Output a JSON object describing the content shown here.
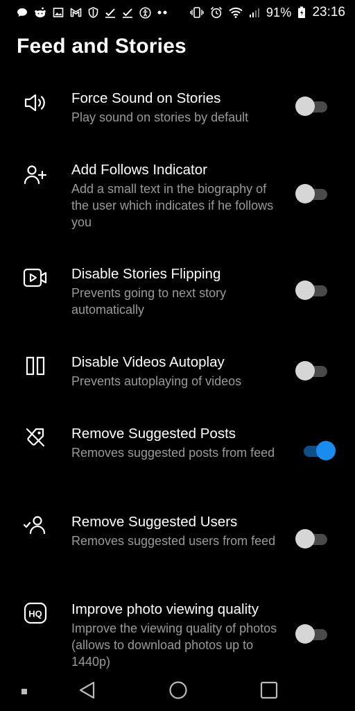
{
  "status_bar": {
    "left_icons": [
      "chat-bubble-icon",
      "reddit-icon",
      "image-icon",
      "gmail-icon",
      "shield-icon",
      "check-icon",
      "check-icon",
      "accessibility-icon",
      "more-dots-icon"
    ],
    "battery": "91%",
    "time": "23:16"
  },
  "page": {
    "title": "Feed and Stories"
  },
  "settings": [
    {
      "icon": "speaker-icon",
      "title": "Force Sound on Stories",
      "desc": "Play sound on stories by default",
      "enabled": false
    },
    {
      "icon": "add-user-icon",
      "title": "Add Follows Indicator",
      "desc": "Add a small text in the biography of the user which indicates if he follows you",
      "enabled": false
    },
    {
      "icon": "video-icon",
      "title": "Disable Stories Flipping",
      "desc": "Prevents going to next story automatically",
      "enabled": false
    },
    {
      "icon": "pause-icon",
      "title": "Disable Videos Autoplay",
      "desc": "Prevents autoplaying of videos",
      "enabled": false
    },
    {
      "icon": "tag-off-icon",
      "title": "Remove Suggested Posts",
      "desc": "Removes suggested posts from feed",
      "enabled": true
    },
    {
      "icon": "user-check-icon",
      "title": "Remove Suggested Users",
      "desc": "Removes suggested users from feed",
      "enabled": false
    },
    {
      "icon": "hq-icon",
      "title": "Improve photo viewing quality",
      "desc": "Improve the viewing quality of photos (allows to download photos up to 1440p)",
      "enabled": false
    }
  ],
  "nav_bar": {
    "items": [
      "recents-dot-icon",
      "back-icon",
      "home-icon",
      "overview-icon"
    ]
  },
  "colors": {
    "background": "#000000",
    "title_text": "#ffffff",
    "description_text": "#9a9a9a",
    "toggle_on": "#1a8cf0",
    "toggle_off_thumb": "#d6d6d6",
    "toggle_off_track": "#4a4a4a"
  }
}
